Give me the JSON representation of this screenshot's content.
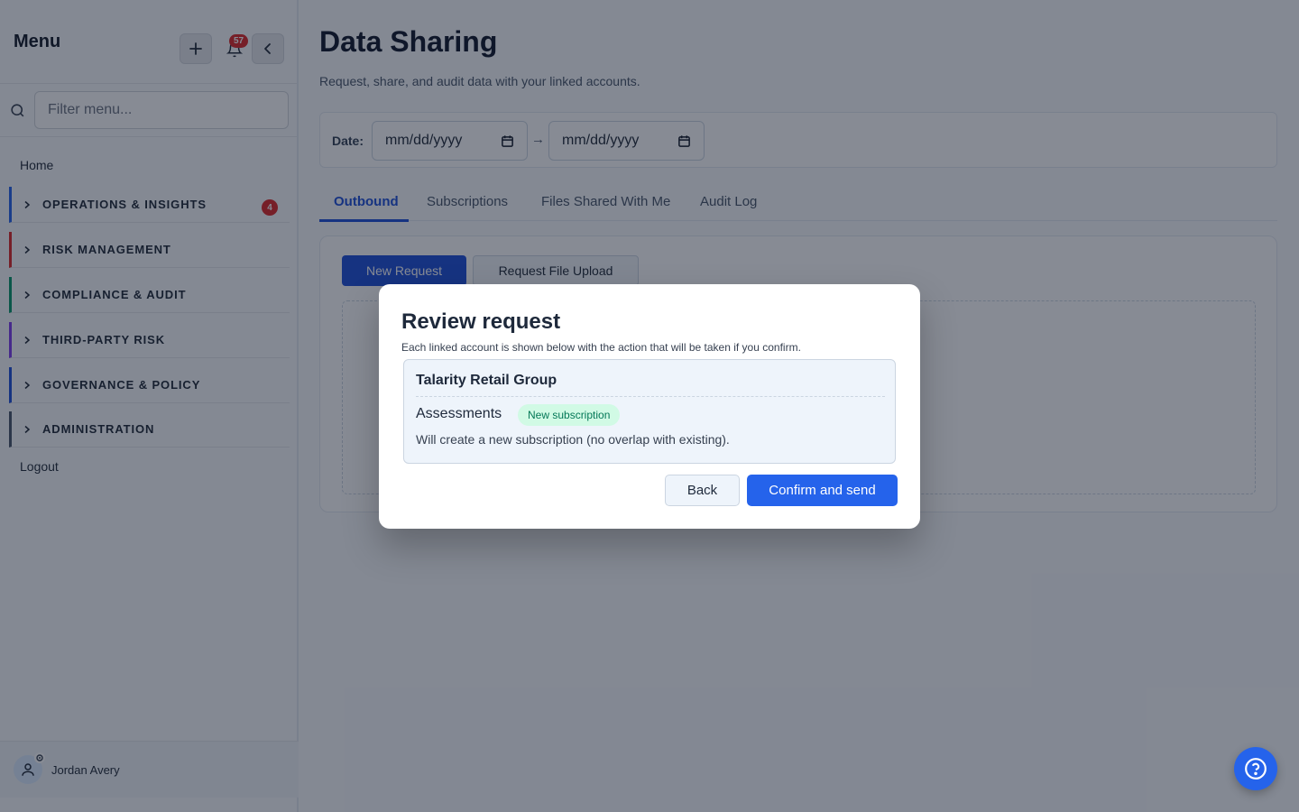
{
  "sidebar": {
    "title": "Menu",
    "notification_count": "57",
    "search_placeholder": "Filter menu...",
    "home_label": "Home",
    "sections": [
      {
        "label": "OPERATIONS & INSIGHTS",
        "accent": "#2563eb",
        "badge": "4"
      },
      {
        "label": "RISK MANAGEMENT",
        "accent": "#dc2626",
        "badge": ""
      },
      {
        "label": "COMPLIANCE & AUDIT",
        "accent": "#059669",
        "badge": ""
      },
      {
        "label": "THIRD-PARTY RISK",
        "accent": "#7c3aed",
        "badge": ""
      },
      {
        "label": "GOVERNANCE & POLICY",
        "accent": "#1d4ed8",
        "badge": ""
      },
      {
        "label": "ADMINISTRATION",
        "accent": "#475569",
        "badge": ""
      }
    ],
    "logout_label": "Logout",
    "user_name": "Jordan Avery"
  },
  "main": {
    "title": "Data Sharing",
    "subtitle": "Request, share, and audit data with your linked accounts.",
    "filter": {
      "date_label": "Date:",
      "date_from_placeholder": "mm/dd/yyyy",
      "date_to_placeholder": "mm/dd/yyyy",
      "arrow": "→"
    },
    "tabs": [
      {
        "label": "Outbound",
        "active": true
      },
      {
        "label": "Subscriptions",
        "active": false
      },
      {
        "label": "Files Shared With Me",
        "active": false
      },
      {
        "label": "Audit Log",
        "active": false
      }
    ],
    "new_request_label": "New Request",
    "request_upload_label": "Request File Upload"
  },
  "modal": {
    "title": "Review request",
    "description": "Each linked account is shown below with the action that will be taken if you confirm.",
    "account": {
      "name": "Talarity Retail Group",
      "item": "Assessments",
      "status": "New subscription",
      "action_text": "Will create a new subscription (no overlap with existing)."
    },
    "back_label": "Back",
    "confirm_label": "Confirm and send"
  },
  "colors": {
    "primary": "#2563eb",
    "badge": "#dc2626",
    "status_new": "#047857"
  }
}
